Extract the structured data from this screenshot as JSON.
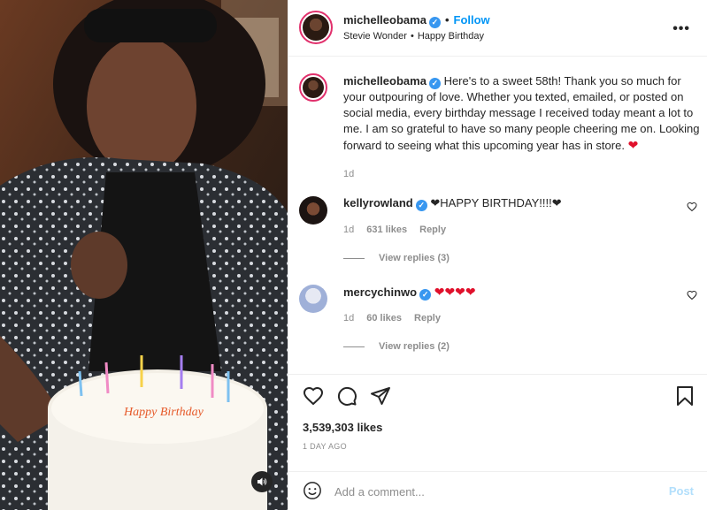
{
  "media": {
    "audio_icon": "speaker-icon"
  },
  "header": {
    "username": "michelleobama",
    "dot": "•",
    "follow_label": "Follow",
    "audio_artist": "Stevie Wonder",
    "audio_sep": "•",
    "audio_title": "Happy Birthday",
    "more_label": "•••"
  },
  "caption": {
    "username": "michelleobama",
    "text": "Here's to a sweet 58th! Thank you so much for your outpouring of love. Whether you texted, emailed, or posted on social media, every birthday message I received today meant a lot to me. I am so grateful to have so many people cheering me on. Looking forward to seeing what this upcoming year has in store.",
    "emoji": "❤",
    "time": "1d"
  },
  "comments": [
    {
      "username": "kellyrowland",
      "text": "❤HAPPY BIRTHDAY!!!!❤",
      "time": "1d",
      "likes": "631 likes",
      "reply_label": "Reply",
      "view_replies": "View replies (3)"
    },
    {
      "username": "mercychinwo",
      "text": "❤❤❤❤",
      "time": "1d",
      "likes": "60 likes",
      "reply_label": "Reply",
      "view_replies": "View replies (2)"
    }
  ],
  "actions": {
    "likes": "3,539,303 likes",
    "time": "1 DAY AGO"
  },
  "add_comment": {
    "placeholder": "Add a comment...",
    "post_label": "Post"
  },
  "colors": {
    "accent": "#0095f6",
    "verified": "#3897f0",
    "heart": "#e0102b",
    "post_disabled": "#b2dffc"
  }
}
